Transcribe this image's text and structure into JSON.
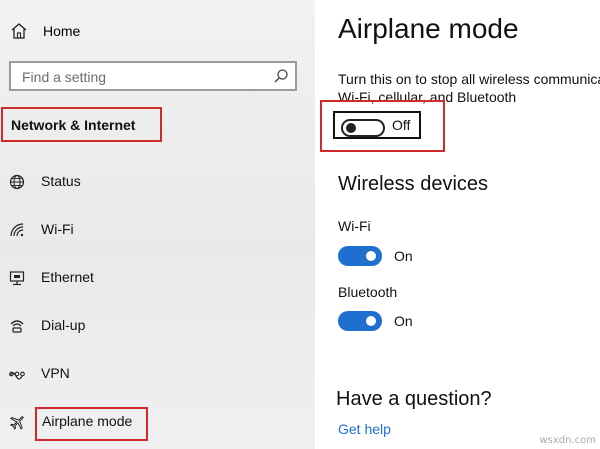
{
  "sidebar": {
    "home_label": "Home",
    "search_placeholder": "Find a setting",
    "section_title": "Network & Internet",
    "items": [
      {
        "label": "Status",
        "icon": "globe-icon"
      },
      {
        "label": "Wi-Fi",
        "icon": "wifi-icon"
      },
      {
        "label": "Ethernet",
        "icon": "ethernet-icon"
      },
      {
        "label": "Dial-up",
        "icon": "dial-up-icon"
      },
      {
        "label": "VPN",
        "icon": "vpn-icon"
      },
      {
        "label": "Airplane mode",
        "icon": "airplane-icon",
        "selected": true
      }
    ]
  },
  "main": {
    "title": "Airplane mode",
    "description_line1": "Turn this on to stop all wireless communica",
    "description_line2": "Wi-Fi, cellular, and Bluetooth",
    "airplane_toggle": {
      "state_label": "Off",
      "on": false
    },
    "wireless_heading": "Wireless devices",
    "wifi": {
      "label": "Wi-Fi",
      "state_label": "On",
      "on": true
    },
    "bluetooth": {
      "label": "Bluetooth",
      "state_label": "On",
      "on": true
    },
    "question_heading": "Have a question?",
    "help_link": "Get help"
  },
  "watermark": "wsxdn.com",
  "colors": {
    "accent": "#1f6fd1",
    "highlight_box": "#d02b2b",
    "sidebar_bg": "#efefef"
  }
}
